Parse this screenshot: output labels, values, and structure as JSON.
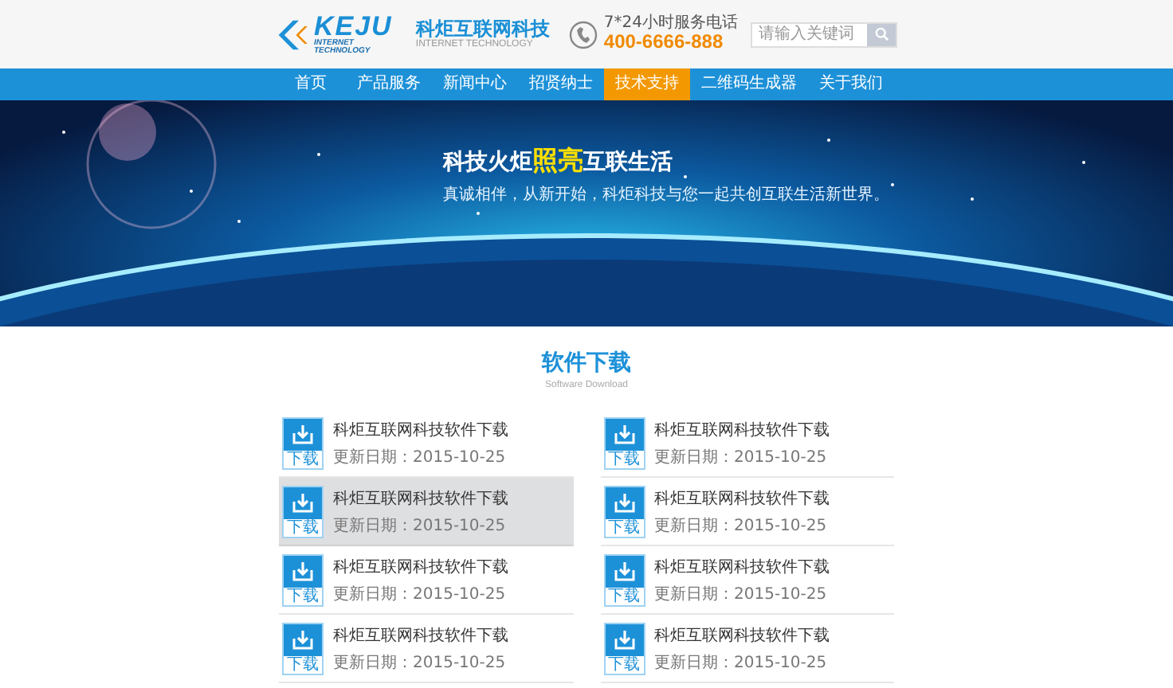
{
  "header": {
    "logo_mark": "KEJU",
    "logo_tagline": "INTERNET TECHNOLOGY",
    "brand_name": "科炬互联网科技",
    "brand_subtitle": "INTERNET TECHNOLOGY",
    "hotline_label": "7*24小时服务电话",
    "hotline_number": "400-6666-888",
    "search": {
      "placeholder": "请输入关键词"
    }
  },
  "nav": [
    {
      "label": "首页",
      "selected": false
    },
    {
      "label": "产品服务",
      "selected": false
    },
    {
      "label": "新闻中心",
      "selected": false
    },
    {
      "label": "招贤纳士",
      "selected": false
    },
    {
      "label": "技术支持",
      "selected": true
    },
    {
      "label": "二维码生成器",
      "selected": false
    },
    {
      "label": "关于我们",
      "selected": false
    }
  ],
  "banner": {
    "headline": [
      {
        "text": "科技火炬",
        "highlight": false
      },
      {
        "text": "照亮",
        "highlight": true
      },
      {
        "text": "互联生活",
        "highlight": false
      }
    ],
    "subline": "真诚相伴，从新开始，科炬科技与您一起共创互联生活新世界。"
  },
  "section": {
    "title": "软件下载",
    "subtitle": "Software Download"
  },
  "downloads": [
    {
      "icon_label": "下载",
      "title": "科炬互联网科技软件下载",
      "date": "更新日期：2015-10-25",
      "selected": false
    },
    {
      "icon_label": "下载",
      "title": "科炬互联网科技软件下载",
      "date": "更新日期：2015-10-25",
      "selected": false
    },
    {
      "icon_label": "下载",
      "title": "科炬互联网科技软件下载",
      "date": "更新日期：2015-10-25",
      "selected": true
    },
    {
      "icon_label": "下载",
      "title": "科炬互联网科技软件下载",
      "date": "更新日期：2015-10-25",
      "selected": false
    },
    {
      "icon_label": "下载",
      "title": "科炬互联网科技软件下载",
      "date": "更新日期：2015-10-25",
      "selected": false
    },
    {
      "icon_label": "下载",
      "title": "科炬互联网科技软件下载",
      "date": "更新日期：2015-10-25",
      "selected": false
    },
    {
      "icon_label": "下载",
      "title": "科炬互联网科技软件下载",
      "date": "更新日期：2015-10-25",
      "selected": false
    },
    {
      "icon_label": "下载",
      "title": "科炬互联网科技软件下载",
      "date": "更新日期：2015-10-25",
      "selected": false
    }
  ]
}
